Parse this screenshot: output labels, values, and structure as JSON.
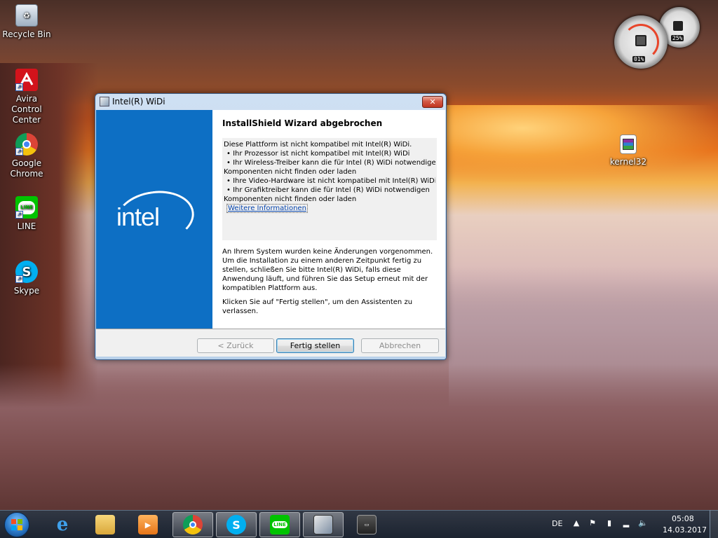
{
  "desktop": {
    "icons": [
      {
        "label": "Recycle Bin",
        "icon": "recycle-bin-icon"
      },
      {
        "label": "Avira Control Center",
        "icon": "avira-icon"
      },
      {
        "label": "Google Chrome",
        "icon": "chrome-icon"
      },
      {
        "label": "LINE",
        "icon": "line-icon"
      },
      {
        "label": "Skype",
        "icon": "skype-icon"
      },
      {
        "label": "kernel32",
        "icon": "winrar-archive-icon"
      }
    ],
    "gadget": {
      "cpu": "01%",
      "memory": "25%"
    }
  },
  "window": {
    "title": "Intel(R) WiDi",
    "close_glyph": "✕",
    "banner_text": "intel",
    "heading": "InstallShield Wizard abgebrochen",
    "messages": [
      "Diese Plattform ist nicht kompatibel mit Intel(R) WiDi.",
      "• Ihr Prozessor ist nicht kompatibel mit Intel(R) WiDi",
      "• Ihr Wireless-Treiber kann die für Intel (R) WiDi notwendigen",
      "Komponenten nicht finden oder laden",
      "• Ihre Video-Hardware ist nicht kompatibel mit Intel(R) WiDi",
      "• Ihr Grafiktreiber kann die für Intel (R) WiDi notwendigen",
      "Komponenten nicht finden oder laden"
    ],
    "link": "Weitere Informationen",
    "paragraph1": "An Ihrem System wurden keine Änderungen vorgenommen. Um die Installation zu einem anderen Zeitpunkt fertig zu stellen, schließen Sie bitte Intel(R) WiDi, falls diese Anwendung läuft, und führen Sie das Setup erneut mit der kompatiblen Plattform aus.",
    "paragraph2": "Klicken Sie auf \"Fertig stellen\", um den Assistenten zu verlassen.",
    "buttons": {
      "back": "< Zurück",
      "finish": "Fertig stellen",
      "cancel": "Abbrechen"
    }
  },
  "taskbar": {
    "apps": [
      "internet-explorer-icon",
      "file-explorer-icon",
      "media-player-icon",
      "chrome-icon",
      "skype-icon",
      "line-icon",
      "installer-icon",
      "asus-icon"
    ],
    "language": "DE",
    "time": "05:08",
    "date": "14.03.2017",
    "colors": {
      "accent": "#0d6fc4"
    }
  }
}
